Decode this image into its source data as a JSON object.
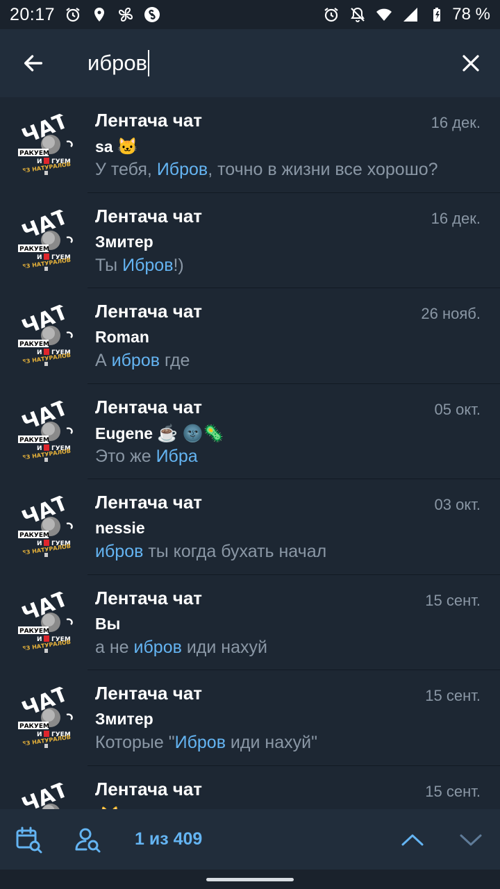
{
  "status_bar": {
    "time": "20:17",
    "battery": "78 %",
    "left_icons": [
      "alarm-icon",
      "location-icon",
      "fan-icon",
      "shazam-icon"
    ],
    "right_icons": [
      "alarm-icon",
      "mute-icon",
      "wifi-icon",
      "signal-icon",
      "battery-icon"
    ]
  },
  "search": {
    "query": "ибров"
  },
  "results": [
    {
      "title": "Лентача чат",
      "date": "16 дек.",
      "sender": "sa",
      "sender_emoji": "🐱",
      "msg_before": "У тебя, ",
      "msg_match": "Ибров",
      "msg_after": ", точно в жизни все хорошо?"
    },
    {
      "title": "Лентача чат",
      "date": "16 дек.",
      "sender": "Змитер",
      "sender_emoji": "",
      "msg_before": "Ты ",
      "msg_match": "Ибров",
      "msg_after": "!)"
    },
    {
      "title": "Лентача чат",
      "date": "26 нояб.",
      "sender": "Roman",
      "sender_emoji": "",
      "msg_before": "А ",
      "msg_match": "ибров",
      "msg_after": " где"
    },
    {
      "title": "Лентача чат",
      "date": "05 окт.",
      "sender": "Eugene",
      "sender_emoji": "☕ 🌚🦠",
      "msg_before": "Это же ",
      "msg_match": "Ибра",
      "msg_after": ""
    },
    {
      "title": "Лентача чат",
      "date": "03 окт.",
      "sender": "nessie",
      "sender_emoji": "",
      "msg_before": "",
      "msg_match": "ибров",
      "msg_after": " ты когда бухать начал"
    },
    {
      "title": "Лентача чат",
      "date": "15 сент.",
      "sender": "Вы",
      "sender_emoji": "",
      "msg_before": "а не ",
      "msg_match": "ибров",
      "msg_after": " иди нахуй"
    },
    {
      "title": "Лентача чат",
      "date": "15 сент.",
      "sender": "Змитер",
      "sender_emoji": "",
      "msg_before": "Которые \"",
      "msg_match": "Ибров",
      "msg_after": " иди нахуй\""
    },
    {
      "title": "Лентача чат",
      "date": "15 сент.",
      "sender": "",
      "sender_emoji": "🐱",
      "msg_before": "",
      "msg_match": "",
      "msg_after": ""
    }
  ],
  "avatar": {
    "top_text": "ЧАТ",
    "line1": "РАКУЕМ",
    "line2": "И",
    "line2b": "ГУЕМ",
    "line3": "БЕЗ НАТУРАЛОВ"
  },
  "bottom_bar": {
    "counter": "1 из 409"
  },
  "colors": {
    "accent": "#64b4f2",
    "background": "#1d2733",
    "header": "#212d3b",
    "secondary_text": "#8a97a5"
  }
}
